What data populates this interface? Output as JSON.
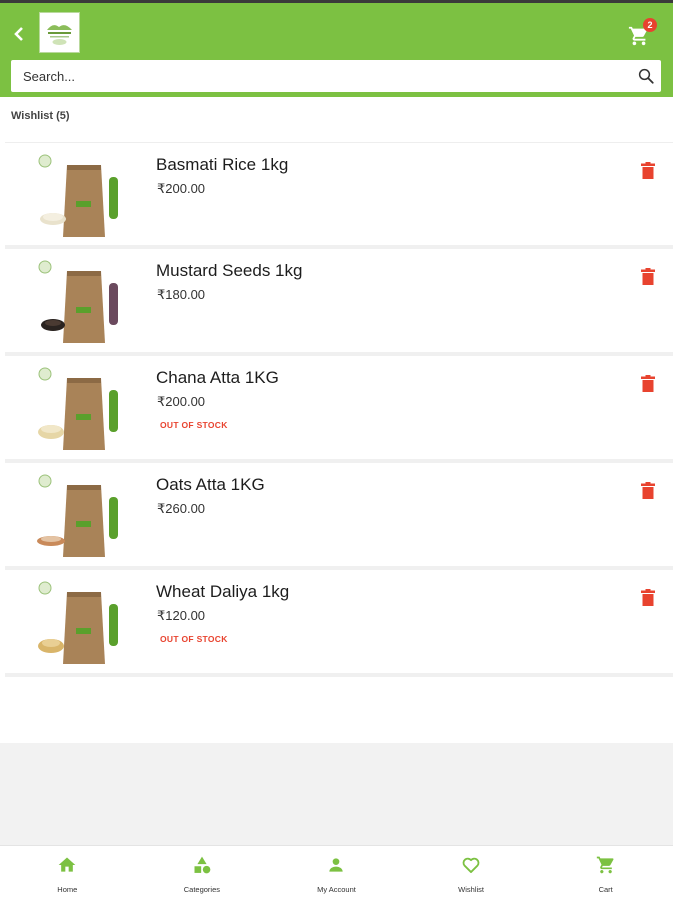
{
  "header": {
    "back_icon": "chevron-left-icon",
    "logo": "brand-logo",
    "cart_icon": "cart-icon",
    "cart_count": "2",
    "bg_color": "#7cc142"
  },
  "search": {
    "placeholder": "Search...",
    "value": "",
    "icon": "search-icon"
  },
  "wishlist": {
    "title": "Wishlist (5)",
    "items": [
      {
        "name": "Basmati Rice 1kg",
        "price": "₹200.00",
        "status": "",
        "band_color": "#5aa02c",
        "grain_color": "#e9e2cc"
      },
      {
        "name": "Mustard Seeds 1kg",
        "price": "₹180.00",
        "status": "",
        "band_color": "#6b4a5e",
        "grain_color": "#2a2320"
      },
      {
        "name": "Chana Atta 1KG",
        "price": "₹200.00",
        "status": "OUT OF STOCK",
        "band_color": "#5aa02c",
        "grain_color": "#e6d6a6"
      },
      {
        "name": "Oats Atta 1KG",
        "price": "₹260.00",
        "status": "",
        "band_color": "#5aa02c",
        "grain_color": "#c98a5a"
      },
      {
        "name": "Wheat Daliya 1kg",
        "price": "₹120.00",
        "status": "OUT OF STOCK",
        "band_color": "#5aa02c",
        "grain_color": "#d9b56a"
      }
    ],
    "delete_icon": "trash-icon",
    "delete_color": "#e8432f"
  },
  "bottom_nav": [
    {
      "label": "Home",
      "icon": "home-icon"
    },
    {
      "label": "Categories",
      "icon": "categories-icon"
    },
    {
      "label": "My Account",
      "icon": "user-icon"
    },
    {
      "label": "Wishlist",
      "icon": "heart-icon"
    },
    {
      "label": "Cart",
      "icon": "cart-icon"
    }
  ],
  "accent_color": "#7cc142"
}
